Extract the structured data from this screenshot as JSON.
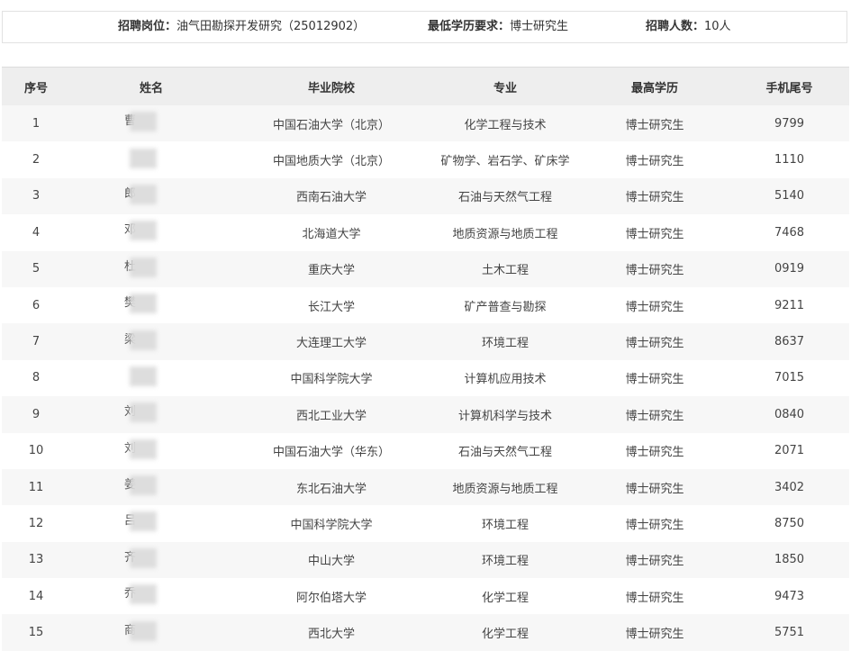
{
  "info": {
    "position_label": "招聘岗位：",
    "position_value": "油气田勘探开发研究（25012902）",
    "education_label": "最低学历要求：",
    "education_value": "博士研究生",
    "count_label": "招聘人数：",
    "count_value": "10人"
  },
  "table": {
    "headers": [
      "序号",
      "姓名",
      "毕业院校",
      "专业",
      "最高学历",
      "手机尾号"
    ],
    "rows": [
      {
        "no": "1",
        "name": "曹",
        "school": "中国石油大学（北京）",
        "major": "化学工程与技术",
        "degree": "博士研究生",
        "phone": "9799"
      },
      {
        "no": "2",
        "name": "",
        "school": "中国地质大学（北京）",
        "major": "矿物学、岩石学、矿床学",
        "degree": "博士研究生",
        "phone": "1110"
      },
      {
        "no": "3",
        "name": "郎",
        "school": "西南石油大学",
        "major": "石油与天然气工程",
        "degree": "博士研究生",
        "phone": "5140"
      },
      {
        "no": "4",
        "name": "邓",
        "school": "北海道大学",
        "major": "地质资源与地质工程",
        "degree": "博士研究生",
        "phone": "7468"
      },
      {
        "no": "5",
        "name": "杜",
        "school": "重庆大学",
        "major": "土木工程",
        "degree": "博士研究生",
        "phone": "0919"
      },
      {
        "no": "6",
        "name": "樊",
        "school": "长江大学",
        "major": "矿产普查与勘探",
        "degree": "博士研究生",
        "phone": "9211"
      },
      {
        "no": "7",
        "name": "梁",
        "school": "大连理工大学",
        "major": "环境工程",
        "degree": "博士研究生",
        "phone": "8637"
      },
      {
        "no": "8",
        "name": "",
        "school": "中国科学院大学",
        "major": "计算机应用技术",
        "degree": "博士研究生",
        "phone": "7015"
      },
      {
        "no": "9",
        "name": "刘",
        "school": "西北工业大学",
        "major": "计算机科学与技术",
        "degree": "博士研究生",
        "phone": "0840"
      },
      {
        "no": "10",
        "name": "刘",
        "school": "中国石油大学（华东）",
        "major": "石油与天然气工程",
        "degree": "博士研究生",
        "phone": "2071"
      },
      {
        "no": "11",
        "name": "姜",
        "school": "东北石油大学",
        "major": "地质资源与地质工程",
        "degree": "博士研究生",
        "phone": "3402"
      },
      {
        "no": "12",
        "name": "吕",
        "school": "中国科学院大学",
        "major": "环境工程",
        "degree": "博士研究生",
        "phone": "8750"
      },
      {
        "no": "13",
        "name": "齐",
        "school": "中山大学",
        "major": "环境工程",
        "degree": "博士研究生",
        "phone": "1850"
      },
      {
        "no": "14",
        "name": "乔",
        "school": "阿尔伯塔大学",
        "major": "化学工程",
        "degree": "博士研究生",
        "phone": "9473"
      },
      {
        "no": "15",
        "name": "商",
        "school": "西北大学",
        "major": "化学工程",
        "degree": "博士研究生",
        "phone": "5751"
      }
    ]
  }
}
